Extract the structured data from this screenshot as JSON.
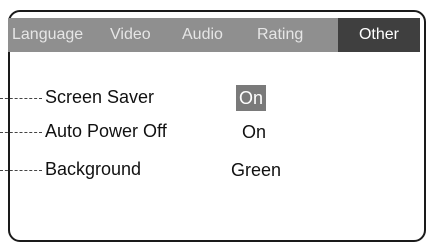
{
  "tabs": [
    {
      "label": "Language",
      "active": false
    },
    {
      "label": "Video",
      "active": false
    },
    {
      "label": "Audio",
      "active": false
    },
    {
      "label": "Rating",
      "active": false
    },
    {
      "label": "Other",
      "active": true
    }
  ],
  "settings": [
    {
      "label": "Screen Saver",
      "value": "On",
      "selected": true
    },
    {
      "label": "Auto Power Off",
      "value": "On",
      "selected": false
    },
    {
      "label": "Background",
      "value": "Green",
      "selected": false
    }
  ],
  "colors": {
    "tab_bar": "#8f8f8f",
    "tab_active": "#3f3f3f",
    "value_highlight": "#7a7a7a"
  }
}
